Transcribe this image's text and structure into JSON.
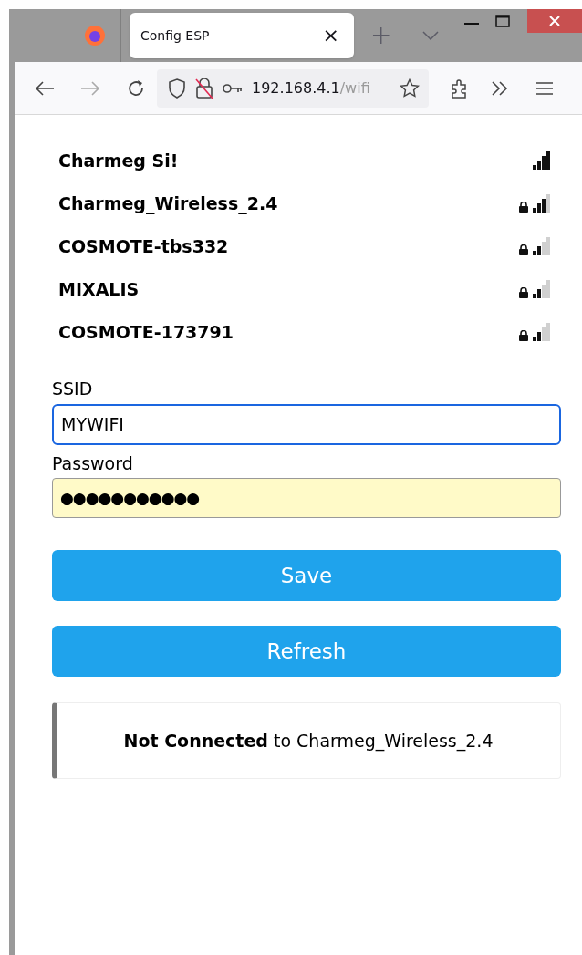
{
  "browser": {
    "tab_title": "Config ESP",
    "tab_close": "×",
    "new_tab": "+",
    "url_host": "192.168.4.1",
    "url_path": "/wifi"
  },
  "networks": [
    {
      "name": "Charmeg Si!",
      "locked": false,
      "kind": "strong"
    },
    {
      "name": "Charmeg_Wireless_2.4",
      "locked": true,
      "kind": "good"
    },
    {
      "name": "COSMOTE-tbs332",
      "locked": true,
      "kind": "fair"
    },
    {
      "name": "MIXALIS",
      "locked": true,
      "kind": "fair"
    },
    {
      "name": "COSMOTE-173791",
      "locked": true,
      "kind": "fair"
    }
  ],
  "form": {
    "ssid_label": "SSID",
    "ssid_value": "MYWIFI",
    "password_label": "Password",
    "password_value": "●●●●●●●●●●●"
  },
  "buttons": [
    "Save",
    "Refresh"
  ],
  "status": "**Not Connected** to Charmeg_Wireless_2.4"
}
